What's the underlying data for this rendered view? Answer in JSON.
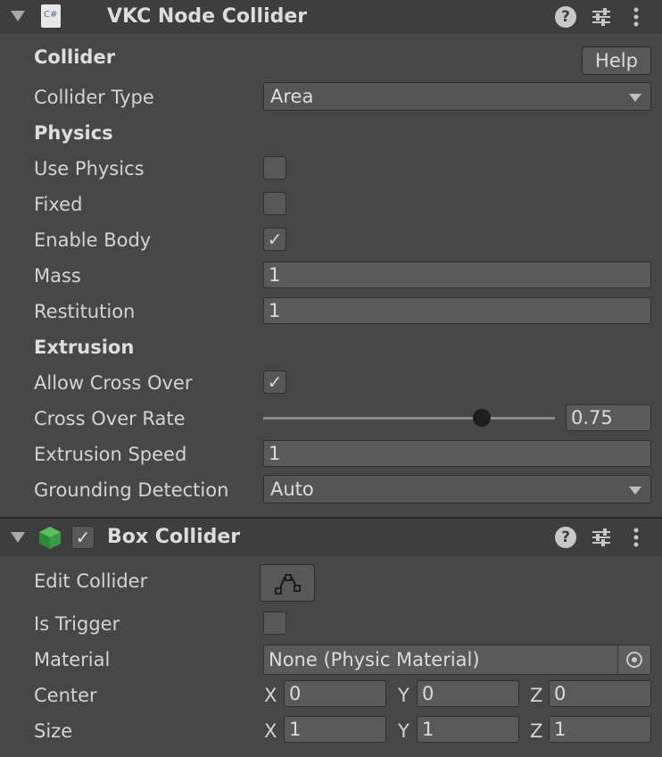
{
  "vkc": {
    "title": "VKC Node Collider",
    "script_icon_text": "C#",
    "help_label": "Help",
    "sections": {
      "collider": "Collider",
      "physics": "Physics",
      "extrusion": "Extrusion"
    },
    "fields": {
      "collider_type_label": "Collider Type",
      "collider_type_value": "Area",
      "use_physics_label": "Use Physics",
      "fixed_label": "Fixed",
      "enable_body_label": "Enable Body",
      "mass_label": "Mass",
      "mass_value": "1",
      "restitution_label": "Restitution",
      "restitution_value": "1",
      "allow_cross_over_label": "Allow Cross Over",
      "cross_over_rate_label": "Cross Over Rate",
      "cross_over_rate_value": "0.75",
      "extrusion_speed_label": "Extrusion Speed",
      "extrusion_speed_value": "1",
      "grounding_detection_label": "Grounding Detection",
      "grounding_detection_value": "Auto"
    },
    "checks": {
      "use_physics": false,
      "fixed": false,
      "enable_body": true,
      "allow_cross_over": true
    },
    "slider_fraction": 0.75
  },
  "box": {
    "title": "Box Collider",
    "enabled": true,
    "fields": {
      "edit_collider_label": "Edit Collider",
      "is_trigger_label": "Is Trigger",
      "material_label": "Material",
      "material_value": "None (Physic Material)",
      "center_label": "Center",
      "size_label": "Size"
    },
    "center": {
      "x_label": "X",
      "x": "0",
      "y_label": "Y",
      "y": "0",
      "z_label": "Z",
      "z": "0"
    },
    "size": {
      "x_label": "X",
      "x": "1",
      "y_label": "Y",
      "y": "1",
      "z_label": "Z",
      "z": "1"
    }
  },
  "icons": {
    "help": "?",
    "check": "✓"
  },
  "colors": {
    "background": "#474747",
    "header": "#3e3e3e",
    "cube_green": "#3c9a46"
  }
}
